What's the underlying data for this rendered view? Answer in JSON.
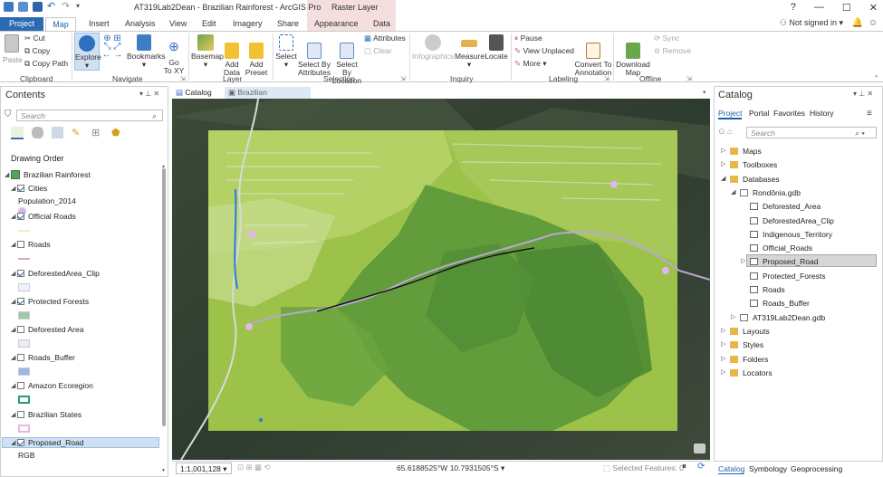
{
  "app": {
    "title": "AT319Lab2Dean - Brazilian Rainforest - ArcGIS Pro",
    "context_tab_group": "Raster Layer",
    "help": "?",
    "signin": "Not signed in"
  },
  "tabs": [
    "Project",
    "Map",
    "Insert",
    "Analysis",
    "View",
    "Edit",
    "Imagery",
    "Share",
    "Appearance",
    "Data"
  ],
  "ribbon": {
    "clipboard": {
      "group": "Clipboard",
      "paste": "Paste",
      "cut": "Cut",
      "copy": "Copy",
      "copy_path": "Copy Path"
    },
    "navigate": {
      "group": "Navigate",
      "explore": "Explore",
      "bookmarks": "Bookmarks",
      "goto_xy": "Go\nTo XY"
    },
    "layer": {
      "group": "Layer",
      "basemap": "Basemap",
      "add_data": "Add\nData",
      "add_preset": "Add\nPreset"
    },
    "selection": {
      "group": "Selection",
      "select": "Select",
      "select_by_attributes": "Select By\nAttributes",
      "select_by_location": "Select By\nLocation",
      "attributes": "Attributes",
      "clear": "Clear"
    },
    "inquiry": {
      "group": "Inquiry",
      "infographics": "Infographics",
      "measure": "Measure",
      "locate": "Locate"
    },
    "labeling": {
      "group": "Labeling",
      "pause": "Pause",
      "view_unplaced": "View Unplaced",
      "more": "More",
      "convert": "Convert To\nAnnotation"
    },
    "offline": {
      "group": "Offline",
      "download_map": "Download\nMap",
      "sync": "Sync",
      "remove": "Remove"
    }
  },
  "contents": {
    "title": "Contents",
    "search_placeholder": "Search",
    "drawing_order": "Drawing Order",
    "map_name": "Brazilian Rainforest",
    "layers": [
      {
        "name": "Cities",
        "checked": true,
        "sub": "Population_2014"
      },
      {
        "name": "Official Roads",
        "checked": true
      },
      {
        "name": "Roads",
        "checked": false
      },
      {
        "name": "DeforestedArea_Clip",
        "checked": true
      },
      {
        "name": "Protected Forests",
        "checked": true
      },
      {
        "name": "Deforested Area",
        "checked": false
      },
      {
        "name": "Roads_Buffer",
        "checked": false
      },
      {
        "name": "Amazon Ecoregion",
        "checked": false
      },
      {
        "name": "Brazilian States",
        "checked": false
      },
      {
        "name": "Proposed_Road",
        "checked": true,
        "sub": "RGB"
      }
    ],
    "colors": {
      "cities": "#d9b8e8",
      "official_roads": "#e6efd0",
      "roads": "#d9a6c8",
      "deforested_clip": "#eef1f8",
      "protected": "#9ec9a6",
      "deforested": "#e8ecf5",
      "buffer": "#9db8e8",
      "ecoregion": "#2a9a72",
      "states": "#e8b8e0"
    }
  },
  "doc_tabs": {
    "catalog": "Catalog",
    "map": "Brazilian Rainforest"
  },
  "map_status": {
    "scale": "1:1,001,128",
    "coords": "65.6188525°W 10.7931505°S",
    "selected": "Selected Features: 0"
  },
  "catalog": {
    "title": "Catalog",
    "tabs": [
      "Project",
      "Portal",
      "Favorites",
      "History"
    ],
    "search_placeholder": "Search",
    "items": [
      {
        "label": "Maps",
        "level": 0
      },
      {
        "label": "Toolboxes",
        "level": 0
      },
      {
        "label": "Databases",
        "level": 0
      },
      {
        "label": "Rondônia.gdb",
        "level": 1
      },
      {
        "label": "Deforested_Area",
        "level": 2
      },
      {
        "label": "DeforestedArea_Clip",
        "level": 2
      },
      {
        "label": "Indigenous_Territory",
        "level": 2
      },
      {
        "label": "Official_Roads",
        "level": 2
      },
      {
        "label": "Proposed_Road",
        "level": 2
      },
      {
        "label": "Protected_Forests",
        "level": 2
      },
      {
        "label": "Roads",
        "level": 2
      },
      {
        "label": "Roads_Buffer",
        "level": 2
      },
      {
        "label": "AT319Lab2Dean.gdb",
        "level": 1
      },
      {
        "label": "Layouts",
        "level": 0
      },
      {
        "label": "Styles",
        "level": 0
      },
      {
        "label": "Folders",
        "level": 0
      },
      {
        "label": "Locators",
        "level": 0
      }
    ],
    "bottom_tabs": [
      "Catalog",
      "Symbology",
      "Geoprocessing"
    ]
  }
}
